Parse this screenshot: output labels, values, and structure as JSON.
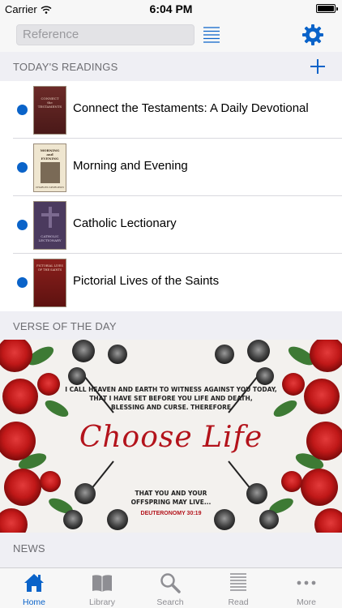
{
  "status_bar": {
    "carrier": "Carrier",
    "time": "6:04 PM"
  },
  "nav": {
    "search_placeholder": "Reference"
  },
  "todays_readings": {
    "header": "TODAY'S READINGS",
    "items": [
      {
        "title": "Connect the Testaments: A Daily Devotional",
        "cover_lines": [
          "CONNECT",
          "the",
          "TESTAMENTS"
        ],
        "unread": true
      },
      {
        "title": "Morning and Evening",
        "cover_lines": [
          "MORNING",
          "and",
          "EVENING"
        ],
        "cover_author": "CHARLES SPURGEON",
        "unread": true
      },
      {
        "title": "Catholic Lectionary",
        "cover_lines": [
          "CATHOLIC",
          "LECTIONARY"
        ],
        "unread": true
      },
      {
        "title": "Pictorial Lives of the Saints",
        "cover_lines": [
          "PICTORIAL LIVES",
          "OF THE SAINTS"
        ],
        "unread": true
      }
    ]
  },
  "verse_of_the_day": {
    "header": "VERSE OF THE DAY",
    "lines_top": [
      "I CALL HEAVEN AND EARTH TO WITNESS AGAINST YOU TODAY,",
      "THAT I HAVE SET BEFORE YOU LIFE AND DEATH,",
      "BLESSING AND CURSE. THEREFORE"
    ],
    "headline": "Choose Life",
    "lines_bottom": [
      "THAT YOU AND YOUR",
      "OFFSPRING MAY LIVE..."
    ],
    "reference": "DEUTERONOMY 30:19"
  },
  "news": {
    "header": "NEWS"
  },
  "tabbar": {
    "tabs": [
      {
        "label": "Home",
        "icon": "home-icon",
        "active": true
      },
      {
        "label": "Library",
        "icon": "book-icon",
        "active": false
      },
      {
        "label": "Search",
        "icon": "search-icon",
        "active": false
      },
      {
        "label": "Read",
        "icon": "read-icon",
        "active": false
      },
      {
        "label": "More",
        "icon": "more-icon",
        "active": false
      }
    ]
  },
  "colors": {
    "accent": "#0a63c9",
    "header_bg": "#efeff4",
    "verse_red": "#b3131b"
  }
}
